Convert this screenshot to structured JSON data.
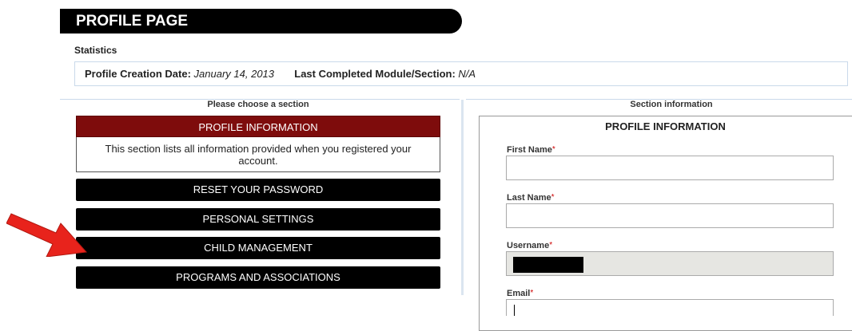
{
  "page": {
    "title": "PROFILE PAGE"
  },
  "statistics": {
    "heading": "Statistics",
    "creation_label": "Profile Creation Date:",
    "creation_value": "January 14, 2013",
    "last_module_label": "Last Completed Module/Section:",
    "last_module_value": "N/A"
  },
  "left": {
    "title": "Please choose a section",
    "active_section": {
      "label": "PROFILE INFORMATION",
      "description": "This section lists all information provided when you registered your account."
    },
    "sections": [
      {
        "label": "RESET YOUR PASSWORD"
      },
      {
        "label": "PERSONAL SETTINGS"
      },
      {
        "label": "CHILD MANAGEMENT"
      },
      {
        "label": "PROGRAMS AND ASSOCIATIONS"
      }
    ]
  },
  "right": {
    "title": "Section information",
    "form_title": "PROFILE INFORMATION",
    "required_mark": "*",
    "fields": [
      {
        "label": "First Name",
        "value": ""
      },
      {
        "label": "Last Name",
        "value": ""
      },
      {
        "label": "Username",
        "value": ""
      },
      {
        "label": "Email",
        "value": ""
      }
    ]
  },
  "colors": {
    "header_bg": "#000000",
    "active_section_bg": "#7e0c0c",
    "button_bg": "#000000",
    "arrow": "#e8231c",
    "required": "#cc0000"
  },
  "icons": {
    "annotation": "red-arrow-icon"
  }
}
